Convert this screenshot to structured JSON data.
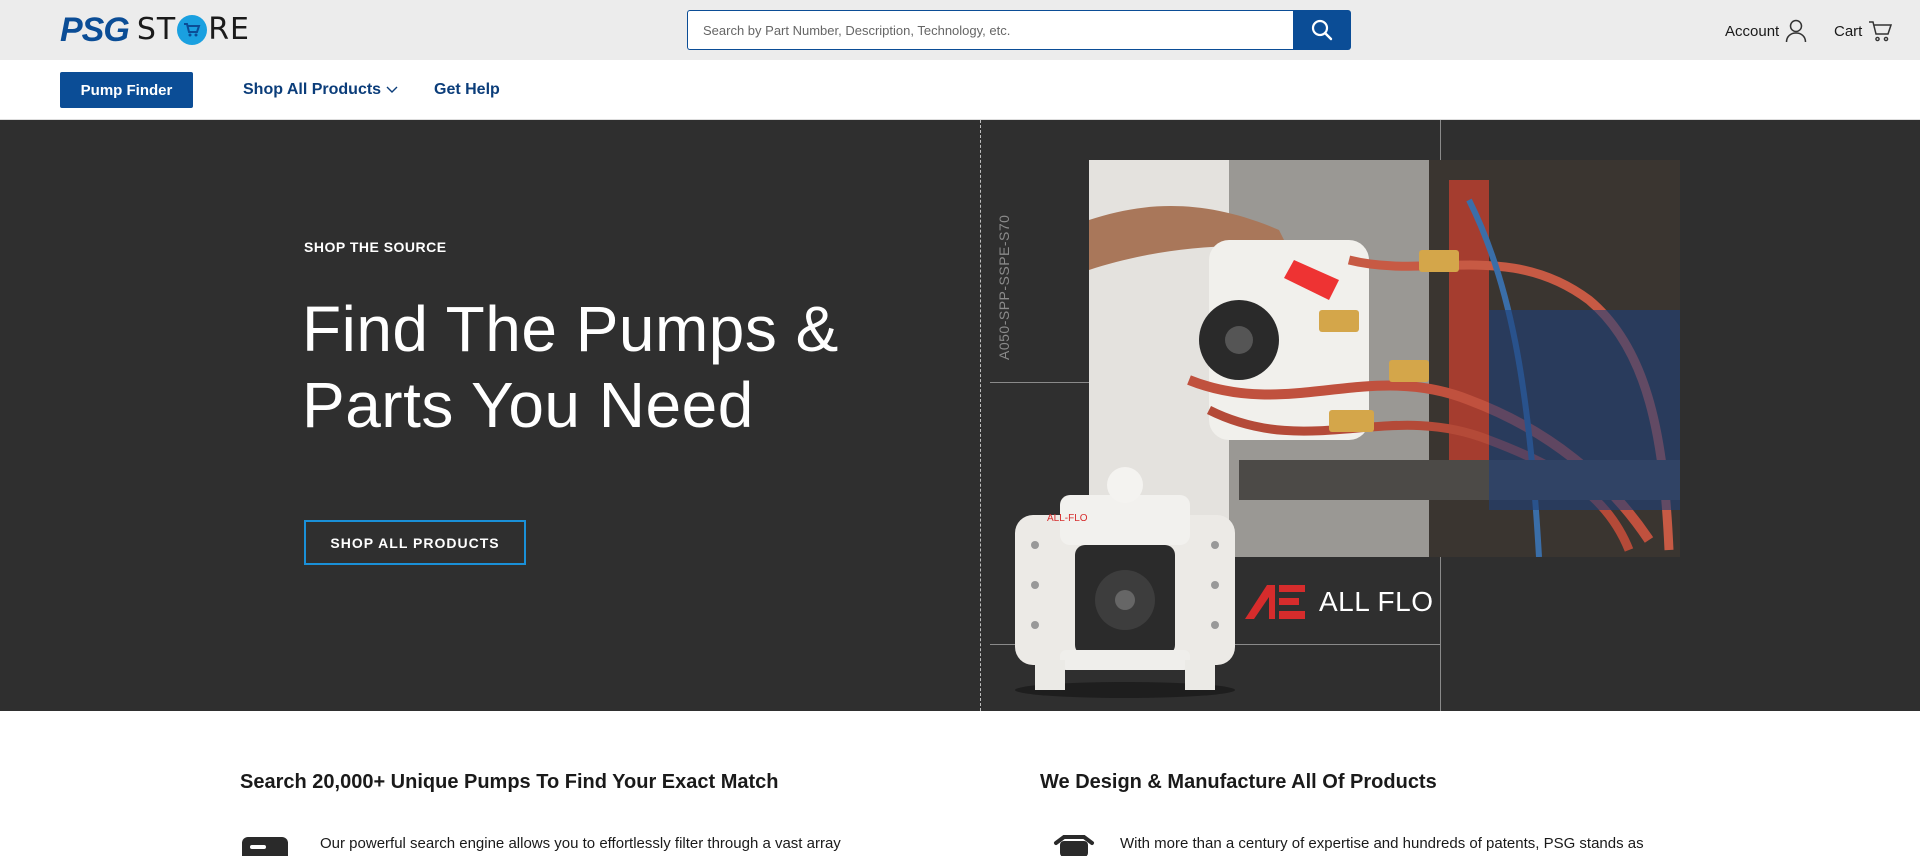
{
  "header": {
    "logo_primary": "PSG",
    "logo_secondary_a": "ST",
    "logo_secondary_b": "RE",
    "search_placeholder": "Search by Part Number, Description, Technology, etc.",
    "search_icon": "search-icon",
    "account_label": "Account",
    "account_icon": "user-icon",
    "cart_label": "Cart",
    "cart_icon": "cart-icon"
  },
  "nav": {
    "pump_finder": "Pump Finder",
    "shop_all": "Shop All Products",
    "get_help": "Get Help"
  },
  "hero": {
    "eyebrow": "SHOP THE SOURCE",
    "title_line1": "Find The Pumps &",
    "title_line2": "Parts You Need",
    "cta": "SHOP ALL PRODUCTS",
    "model_code": "A050-SPP-SSPE-S70",
    "pump_label": "ALL-FLO",
    "brand_name": "ALL FLO"
  },
  "features": [
    {
      "title": "Search 20,000+ Unique Pumps To Find Your Exact Match",
      "text": "Our powerful search engine allows you to effortlessly filter through a vast array",
      "icon": "search-engine-icon"
    },
    {
      "title": "We Design & Manufacture All Of Products",
      "text": "With more than a century of expertise and hundreds of patents, PSG stands as",
      "icon": "pump-icon"
    }
  ],
  "colors": {
    "brand_blue": "#0b4d96",
    "accent_blue": "#1a90d8",
    "hero_bg": "#2f2f2f",
    "allflo_red": "#d62c2c"
  }
}
